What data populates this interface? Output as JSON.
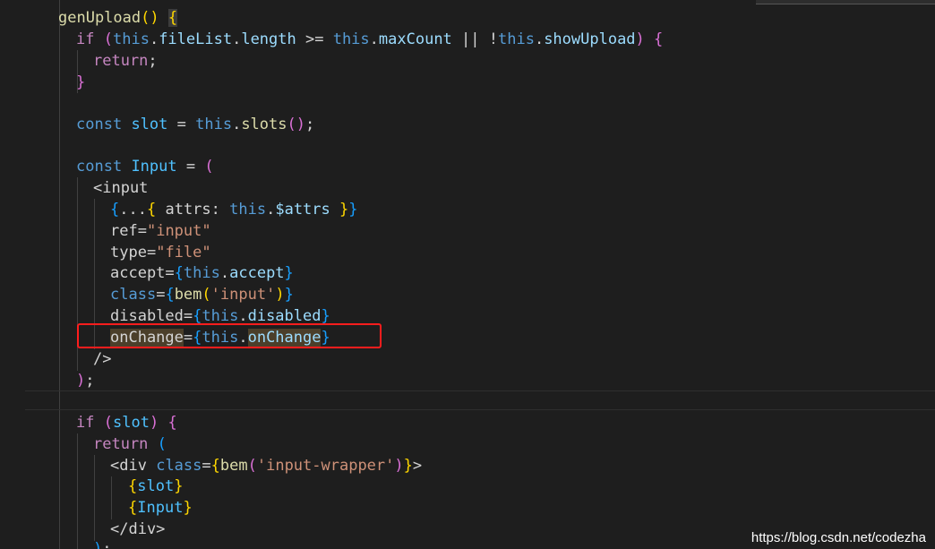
{
  "watermark": "https://blog.csdn.net/codezha",
  "code": {
    "l1_name": "genUpload",
    "l2_if": "if",
    "l2_this": "this",
    "l2_fileList": "fileList",
    "l2_length": "length",
    "l2_op": " >= ",
    "l2_this2": "this",
    "l2_maxCount": "maxCount",
    "l2_or": " || !",
    "l2_this3": "this",
    "l2_showUpload": "showUpload",
    "l3_return": "return",
    "l5_const": "const",
    "l5_slot": "slot",
    "l5_this": "this",
    "l5_slots": "slots",
    "l7_const": "const",
    "l7_Input": "Input",
    "l8_tag": "<input",
    "l9_attrs": "attrs",
    "l9_this": "this",
    "l9_dattrs": "$attrs",
    "l10_ref": "ref",
    "l10_val": "\"input\"",
    "l11_type": "type",
    "l11_val": "\"file\"",
    "l12_accept": "accept",
    "l12_this": "this",
    "l12_acc": "accept",
    "l13_class": "class",
    "l13_bem": "bem",
    "l13_val": "'input'",
    "l14_disabled": "disabled",
    "l14_this": "this",
    "l14_dis": "disabled",
    "l15_onChange": "onChange",
    "l15_this": "this",
    "l15_on": "onChange",
    "l16_close": "/>",
    "l17_close": ");",
    "l19_if": "if",
    "l19_slot": "slot",
    "l20_return": "return",
    "l21_div": "<div",
    "l21_class": "class",
    "l21_bem": "bem",
    "l21_val": "'input-wrapper'",
    "l22_slot": "slot",
    "l23_Input": "Input",
    "l24_close": "</div>",
    "l25_close": ");"
  }
}
